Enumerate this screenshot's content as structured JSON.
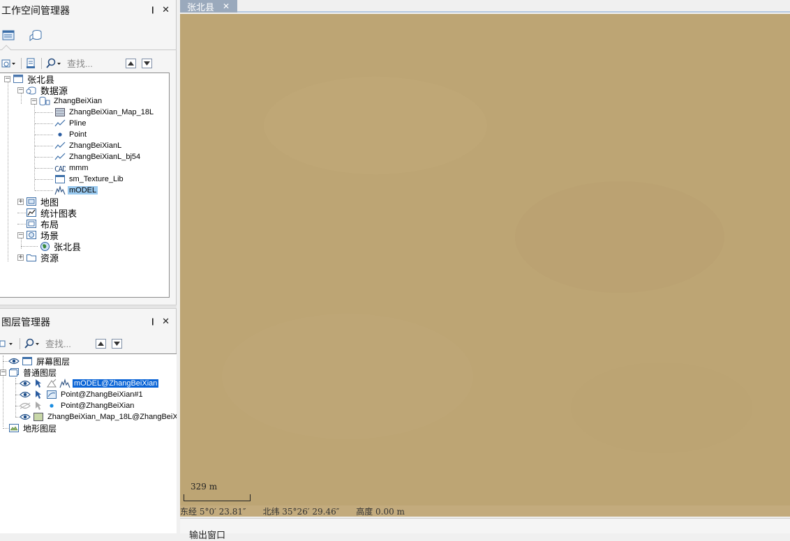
{
  "workspace": {
    "title": "工作空间管理器",
    "search_placeholder": "查找...",
    "tree": {
      "root": "张北县",
      "datasource_group": "数据源",
      "datasource": "ZhangBeiXian",
      "datasets": [
        {
          "label": "ZhangBeiXian_Map_18L",
          "icon": "grid-image-icon"
        },
        {
          "label": "Pline",
          "icon": "line-dataset-icon"
        },
        {
          "label": "Point",
          "icon": "point-dataset-icon"
        },
        {
          "label": "ZhangBeiXianL",
          "icon": "line-dataset-icon"
        },
        {
          "label": "ZhangBeiXianL_bj54",
          "icon": "line-dataset-icon"
        },
        {
          "label": "mmm",
          "icon": "cad-dataset-icon"
        },
        {
          "label": "sm_Texture_Lib",
          "icon": "tabular-dataset-icon"
        },
        {
          "label": "mODEL",
          "icon": "model-dataset-icon"
        }
      ],
      "maps": "地图",
      "charts": "统计图表",
      "layouts": "布局",
      "scenes": "场景",
      "scene_item": "张北县",
      "resources": "资源"
    }
  },
  "layer_manager": {
    "title": "图层管理器",
    "search_placeholder": "查找...",
    "screen_layers": "屏幕图层",
    "normal_layers": "普通图层",
    "layers": [
      {
        "label": "mODEL@ZhangBeiXian",
        "visible": true
      },
      {
        "label": "Point@ZhangBeiXian#1",
        "visible": true
      },
      {
        "label": "Point@ZhangBeiXian",
        "visible": false
      },
      {
        "label": "ZhangBeiXian_Map_18L@ZhangBeiX",
        "visible": true
      }
    ],
    "terrain_layers": "地形图层"
  },
  "document": {
    "tab_label": "张北县",
    "tab_close": "✕"
  },
  "map": {
    "scale_text": "329 m",
    "longitude": "东经 5°0′ 23.81″",
    "latitude": "北纬 35°26′ 29.46″",
    "altitude": "高度 0.00 m"
  },
  "output": {
    "title": "输出窗口"
  },
  "colors": {
    "map_bg": "#bda574",
    "selection": "#0a64d6",
    "doc_tab": "#9aa9bc"
  }
}
